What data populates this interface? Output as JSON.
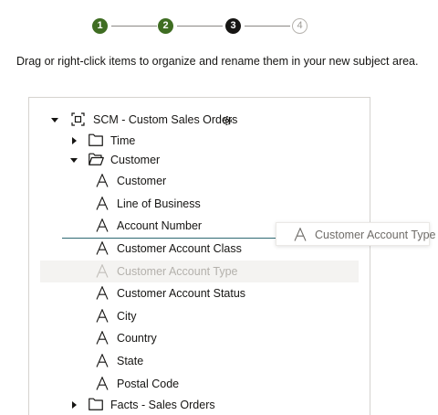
{
  "steps": [
    {
      "number": "1",
      "state": "complete"
    },
    {
      "number": "2",
      "state": "complete"
    },
    {
      "number": "3",
      "state": "current"
    },
    {
      "number": "4",
      "state": "upcoming"
    }
  ],
  "instruction": "Drag or right-click items to organize and rename them in your new subject area.",
  "tree": {
    "root": {
      "label": "SCM - Custom Sales Orders",
      "icon": "subject-area-icon",
      "settings_icon": "gear-icon"
    },
    "folders": {
      "time": {
        "label": "Time",
        "icon": "folder-icon",
        "expanded": false
      },
      "customer": {
        "label": "Customer",
        "icon": "folder-open-icon",
        "expanded": true
      },
      "facts": {
        "label": "Facts - Sales Orders",
        "icon": "folder-icon",
        "expanded": false
      }
    },
    "attributes": [
      {
        "label": "Customer",
        "icon": "attribute-icon"
      },
      {
        "label": "Line of Business",
        "icon": "attribute-icon"
      },
      {
        "label": "Account Number",
        "icon": "attribute-icon"
      },
      {
        "label": "Customer Account Class",
        "icon": "attribute-icon"
      },
      {
        "label": "Customer Account Type",
        "icon": "attribute-icon",
        "state": "dragging"
      },
      {
        "label": "Customer Account Status",
        "icon": "attribute-icon"
      },
      {
        "label": "City",
        "icon": "attribute-icon"
      },
      {
        "label": "Country",
        "icon": "attribute-icon"
      },
      {
        "label": "State",
        "icon": "attribute-icon"
      },
      {
        "label": "Postal Code",
        "icon": "attribute-icon"
      }
    ]
  },
  "drag_ghost": {
    "label": "Customer Account Type",
    "icon": "attribute-icon"
  },
  "colors": {
    "step_complete": "#3f6d22",
    "step_current": "#161513",
    "step_upcoming": "#b6b3ae",
    "drop_indicator": "#2e6a73",
    "ghost_row_bg": "#f4f3f1"
  }
}
